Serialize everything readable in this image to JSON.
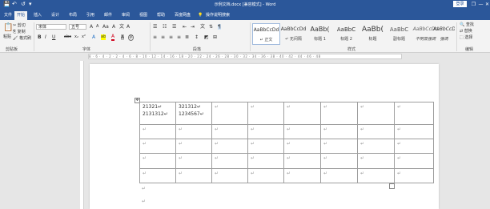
{
  "title_bar": {
    "doc_title": "示例文档.docx [兼容模式] - Word",
    "login_label": "登录",
    "qa_save": "💾",
    "qa_undo": "↶",
    "qa_redo": "↺",
    "qa_custom": "▾",
    "win_restore": "❐",
    "win_min": "—",
    "win_max": "□",
    "win_close": "✕"
  },
  "tabs": [
    "文件",
    "开始",
    "插入",
    "设计",
    "布局",
    "引用",
    "邮件",
    "审阅",
    "视图",
    "帮助",
    "百度网盘"
  ],
  "tell_me": "操作说明搜索",
  "ribbon": {
    "clipboard": {
      "paste": "粘贴",
      "cut": "剪切",
      "copy": "复制",
      "painter": "格式刷",
      "label": "剪贴板"
    },
    "font": {
      "name": "宋体",
      "size": "五号",
      "label": "字体",
      "grow": "A",
      "shrink": "A",
      "case": "Aa",
      "clear": "A",
      "pinyin": "文",
      "border": "A",
      "bold": "B",
      "italic": "I",
      "underline": "U",
      "strike": "abc",
      "sub": "x₂",
      "sup": "x²",
      "effects": "A",
      "highlight": "ab",
      "color": "A",
      "shade": "A",
      "enclose": "字"
    },
    "paragraph": {
      "label": "段落"
    },
    "styles": {
      "label": "样式",
      "items": [
        {
          "preview": "AaBbCcDd",
          "name": "↵ 正文"
        },
        {
          "preview": "AaBbCcDd",
          "name": "↵ 无间隔"
        },
        {
          "preview": "AaBb(",
          "name": "标题 1"
        },
        {
          "preview": "AaBbC",
          "name": "标题 2"
        },
        {
          "preview": "AaBb(",
          "name": "标题"
        },
        {
          "preview": "AaBbC",
          "name": "副标题"
        },
        {
          "preview": "AaBbCcDd",
          "name": "不明显强调"
        },
        {
          "preview": "AaBbCcDd",
          "name": "强调"
        }
      ]
    },
    "editing": {
      "find": "查找",
      "replace": "替换",
      "select": "选择",
      "label": "编辑"
    }
  },
  "ruler_text": "8 · 6 · 4 · 2 · 2 · 4 · 6 · 8 · 10 · 12 · 14 · 16 · 18 · 20 · 22 · 24 · 26 · 28 · 30 · 32 · 34 · 36 · 38 · 40 · 42 · 44 · 46 · 48",
  "table": {
    "rows": [
      [
        "21321↵\n2131312↵",
        "321312↵\n1234567↵",
        "↵",
        "↵",
        "↵",
        "↵",
        "↵",
        "↵"
      ],
      [
        "↵",
        "↵",
        "↵",
        "↵",
        "↵",
        "↵",
        "↵",
        "↵"
      ],
      [
        "↵",
        "↵",
        "↵",
        "↵",
        "↵",
        "↵",
        "↵",
        "↵"
      ],
      [
        "↵",
        "↵",
        "↵",
        "↵",
        "↵",
        "↵",
        "↵",
        "↵"
      ],
      [
        "↵",
        "↵",
        "↵",
        "↵",
        "↵",
        "↵",
        "↵",
        "↵"
      ]
    ],
    "move_handle": "✥"
  },
  "after_table_marks": [
    "↵",
    "↵"
  ]
}
